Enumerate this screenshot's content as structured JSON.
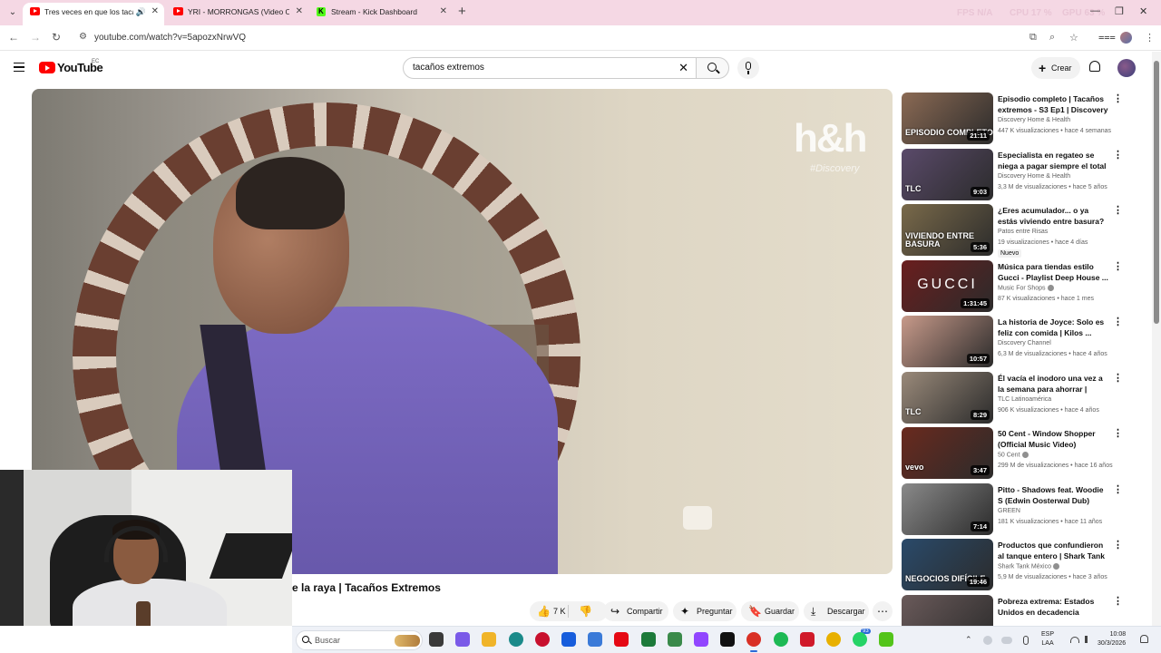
{
  "browser": {
    "tabs": [
      {
        "title": "Tres veces en que los tacañ",
        "audio": "🔊",
        "close": "✕"
      },
      {
        "title": "YRI - MORRONGAS (Video Ofic",
        "close": "✕"
      },
      {
        "title": "Stream - Kick Dashboard",
        "close": "✕"
      }
    ],
    "tab_menu": "⌄",
    "new_tab": "+",
    "overlay": {
      "fps_label": "FPS",
      "fps_value": "N/A",
      "cpu_label": "CPU",
      "cpu_value": "17 %",
      "gpu_label": "GPU",
      "gpu_value": "63 %"
    },
    "window": {
      "minimize": "—",
      "maximize": "❐",
      "close": "✕"
    },
    "nav": {
      "back": "←",
      "forward": "→",
      "reload": "↻"
    },
    "url_icon": "⚙",
    "url": "youtube.com/watch?v=5apozxNrwVQ",
    "right_icons": [
      "⧉",
      "⌕",
      "☆",
      "⩶",
      "⋮"
    ]
  },
  "youtube": {
    "wordmark": "YouTube",
    "country": "EC",
    "search_value": "tacaños extremos",
    "search_clear": "✕",
    "create_label": "Crear",
    "create_plus": "+"
  },
  "player": {
    "watermark": "h&h",
    "watermark_sub": "#Discovery"
  },
  "video": {
    "title_visible": "e la raya | Tacaños Extremos",
    "likes": "7 K",
    "like_icon": "👍",
    "dislike_icon": "👎",
    "share": "Compartir",
    "share_icon": "↪",
    "ask": "Preguntar",
    "ask_icon": "✦",
    "save": "Guardar",
    "save_icon": "🔖",
    "download": "Descargar",
    "download_icon": "⤓",
    "more_icon": "⋯"
  },
  "recommendations": [
    {
      "title": "Episodio completo | Tacaños extremos - S3 Ep1 | Discovery ...",
      "channel": "Discovery Home & Health",
      "views": "447 K visualizaciones",
      "age": "hace 4 semanas",
      "duration": "21:11",
      "thumb_text": "EPISODIO COMPLETO",
      "thumb_color": "#8b6a54",
      "verified": false
    },
    {
      "title": "Especialista en regateo se niega a pagar siempre el total | ...",
      "channel": "Discovery Home & Health",
      "views": "3,3 M de visualizaciones",
      "age": "hace 5 años",
      "duration": "9:03",
      "thumb_text": "TLC",
      "thumb_color": "#5a4a6a",
      "verified": false
    },
    {
      "title": "¿Eres acumulador... o ya estás viviendo entre basura?",
      "channel": "Patos entre Risas",
      "views": "19 visualizaciones",
      "age": "hace 4 días",
      "duration": "5:36",
      "thumb_text": "VIVIENDO ENTRE BASURA",
      "thumb_color": "#7a6a4a",
      "badge": "Nuevo",
      "verified": false
    },
    {
      "title": "Música para tiendas estilo Gucci - Playlist Deep House ...",
      "channel": "Music For Shops",
      "views": "87 K visualizaciones",
      "age": "hace 1 mes",
      "duration": "1:31:45",
      "thumb_big": "GUCCI",
      "thumb_color": "#6a1e1e",
      "verified": true
    },
    {
      "title": "La historia de Joyce: Solo es feliz con comida | Kilos ...",
      "channel": "Discovery Channel",
      "views": "6,3 M de visualizaciones",
      "age": "hace 4 años",
      "duration": "10:57",
      "thumb_text": "",
      "thumb_color": "#c89a8a",
      "verified": false
    },
    {
      "title": "Él vacía el inodoro una vez a la semana para ahorrar | Tacaño...",
      "channel": "TLC Latinoamérica",
      "views": "906 K visualizaciones",
      "age": "hace 4 años",
      "duration": "8:29",
      "thumb_text": "TLC",
      "thumb_color": "#9a8a7a",
      "verified": false
    },
    {
      "title": "50 Cent - Window Shopper (Official Music Video)",
      "channel": "50 Cent",
      "views": "299 M de visualizaciones",
      "age": "hace 16 años",
      "duration": "3:47",
      "thumb_text": "vevo",
      "thumb_color": "#6a2a1e",
      "verified": true
    },
    {
      "title": "Pitto - Shadows feat. Woodie S (Edwin Oosterwal Dub)",
      "channel": "GREEN",
      "views": "181 K visualizaciones",
      "age": "hace 11 años",
      "duration": "7:14",
      "thumb_text": "",
      "thumb_color": "#8a8a8a",
      "verified": false
    },
    {
      "title": "Productos que confundieron al tanque entero | Shark Tank ...",
      "channel": "Shark Tank México",
      "views": "5,9 M de visualizaciones",
      "age": "hace 3 años",
      "duration": "19:46",
      "thumb_text": "NEGOCIOS DIFÍCILE",
      "thumb_color": "#2a4a6a",
      "verified": true
    },
    {
      "title": "Pobreza extrema: Estados Unidos en decadencia",
      "channel": "",
      "views": "",
      "age": "",
      "duration": "",
      "thumb_text": "",
      "thumb_color": "#6a5a5a",
      "verified": false
    }
  ],
  "taskbar": {
    "search_placeholder": "Buscar",
    "badge": "93",
    "tray_up": "⌃",
    "lang_1": "ESP",
    "lang_2": "LAA",
    "time": "10:08",
    "date": "30/3/2026",
    "apps": [
      {
        "name": "task-view",
        "color": "#3a3a3a"
      },
      {
        "name": "copilot",
        "color": "#7a5ae8"
      },
      {
        "name": "file-explorer",
        "color": "#f0b429"
      },
      {
        "name": "edge",
        "color": "#1b8a8a"
      },
      {
        "name": "opera",
        "color": "#c8102e"
      },
      {
        "name": "bitwarden",
        "color": "#175ddc"
      },
      {
        "name": "store",
        "color": "#3a7ad8"
      },
      {
        "name": "netflix",
        "color": "#e50914"
      },
      {
        "name": "upwork",
        "color": "#1d7a3a"
      },
      {
        "name": "app-green",
        "color": "#3a8a4a"
      },
      {
        "name": "twitch",
        "color": "#9146ff"
      },
      {
        "name": "tiktok",
        "color": "#111111"
      },
      {
        "name": "chrome",
        "color": "#d93025"
      },
      {
        "name": "spotify",
        "color": "#1db954"
      },
      {
        "name": "app-red",
        "color": "#d01a2a"
      },
      {
        "name": "app-yellow",
        "color": "#e8b000"
      },
      {
        "name": "whatsapp",
        "color": "#25d366"
      },
      {
        "name": "app-lime",
        "color": "#53c41a"
      }
    ]
  }
}
